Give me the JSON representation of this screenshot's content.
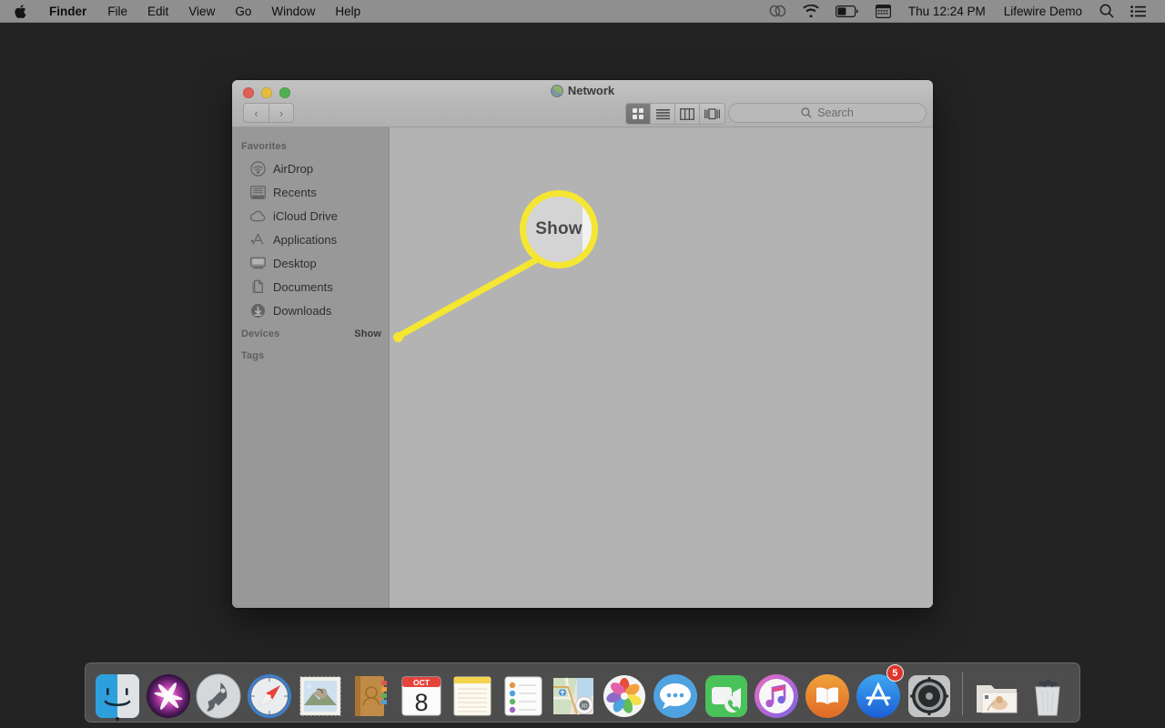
{
  "menubar": {
    "apple_icon": "apple-logo-icon",
    "items": [
      {
        "label": "Finder",
        "bold": true
      },
      {
        "label": "File",
        "bold": false
      },
      {
        "label": "Edit",
        "bold": false
      },
      {
        "label": "View",
        "bold": false
      },
      {
        "label": "Go",
        "bold": false
      },
      {
        "label": "Window",
        "bold": false
      },
      {
        "label": "Help",
        "bold": false
      }
    ],
    "status_icons": [
      "creative-cloud-icon",
      "wifi-icon",
      "battery-icon",
      "calendar-clock-icon"
    ],
    "clock": "Thu 12:24 PM",
    "user": "Lifewire Demo",
    "search_icon": "spotlight-search-icon",
    "control_center_icon": "notification-center-icon"
  },
  "window": {
    "title": "Network",
    "title_icon": "globe-icon",
    "traffic_lights": [
      "close-button",
      "minimize-button",
      "zoom-button"
    ],
    "nav": {
      "back": "‹",
      "forward": "›"
    },
    "view_modes": [
      {
        "name": "icon-view",
        "active": true
      },
      {
        "name": "list-view",
        "active": false
      },
      {
        "name": "column-view",
        "active": false
      },
      {
        "name": "gallery-view",
        "active": false
      }
    ],
    "group_button": "group-items-button",
    "action_button": "action-gear-button",
    "share_button": "share-button",
    "tag_button": "tag-button",
    "search": {
      "placeholder": "Search",
      "icon": "search-icon",
      "value": ""
    }
  },
  "sidebar": {
    "sections": [
      {
        "header": "Favorites",
        "items": [
          {
            "label": "AirDrop",
            "icon": "airdrop-icon"
          },
          {
            "label": "Recents",
            "icon": "recents-icon"
          },
          {
            "label": "iCloud Drive",
            "icon": "icloud-icon"
          },
          {
            "label": "Applications",
            "icon": "applications-icon"
          },
          {
            "label": "Desktop",
            "icon": "desktop-icon"
          },
          {
            "label": "Documents",
            "icon": "documents-icon"
          },
          {
            "label": "Downloads",
            "icon": "downloads-icon"
          }
        ]
      },
      {
        "header": "Devices",
        "show_label": "Show",
        "items": []
      },
      {
        "header": "Tags",
        "items": []
      }
    ]
  },
  "callout": {
    "magnified_text": "Show",
    "highlight_color": "#f5e633",
    "target": "devices-show-button"
  },
  "dock": {
    "items": [
      {
        "label": "Finder",
        "icon": "finder-icon",
        "running": true
      },
      {
        "label": "Siri",
        "icon": "siri-icon",
        "running": false
      },
      {
        "label": "Launchpad",
        "icon": "launchpad-icon",
        "running": false
      },
      {
        "label": "Safari",
        "icon": "safari-icon",
        "running": false
      },
      {
        "label": "Mail",
        "icon": "mail-icon",
        "running": false
      },
      {
        "label": "Contacts",
        "icon": "contacts-icon",
        "running": false
      },
      {
        "label": "Calendar",
        "icon": "calendar-icon",
        "running": false,
        "month": "OCT",
        "day": "8"
      },
      {
        "label": "Notes",
        "icon": "notes-icon",
        "running": false
      },
      {
        "label": "Reminders",
        "icon": "reminders-icon",
        "running": false
      },
      {
        "label": "Maps",
        "icon": "maps-icon",
        "running": false
      },
      {
        "label": "Photos",
        "icon": "photos-icon",
        "running": false
      },
      {
        "label": "Messages",
        "icon": "messages-icon",
        "running": false
      },
      {
        "label": "FaceTime",
        "icon": "facetime-icon",
        "running": false
      },
      {
        "label": "iTunes",
        "icon": "itunes-icon",
        "running": false
      },
      {
        "label": "Books",
        "icon": "books-icon",
        "running": false
      },
      {
        "label": "App Store",
        "icon": "app-store-icon",
        "running": false,
        "badge": "5"
      },
      {
        "label": "System Preferences",
        "icon": "system-preferences-icon",
        "running": false
      }
    ],
    "right_items": [
      {
        "label": "Downloads Folder",
        "icon": "downloads-folder-icon"
      },
      {
        "label": "Trash",
        "icon": "trash-icon"
      }
    ]
  },
  "colors": {
    "desktop": "#232323",
    "menubar": "#8f8f8f",
    "sidebar": "#989898",
    "content": "#b3b3b3",
    "accent_yellow": "#f5e633"
  }
}
